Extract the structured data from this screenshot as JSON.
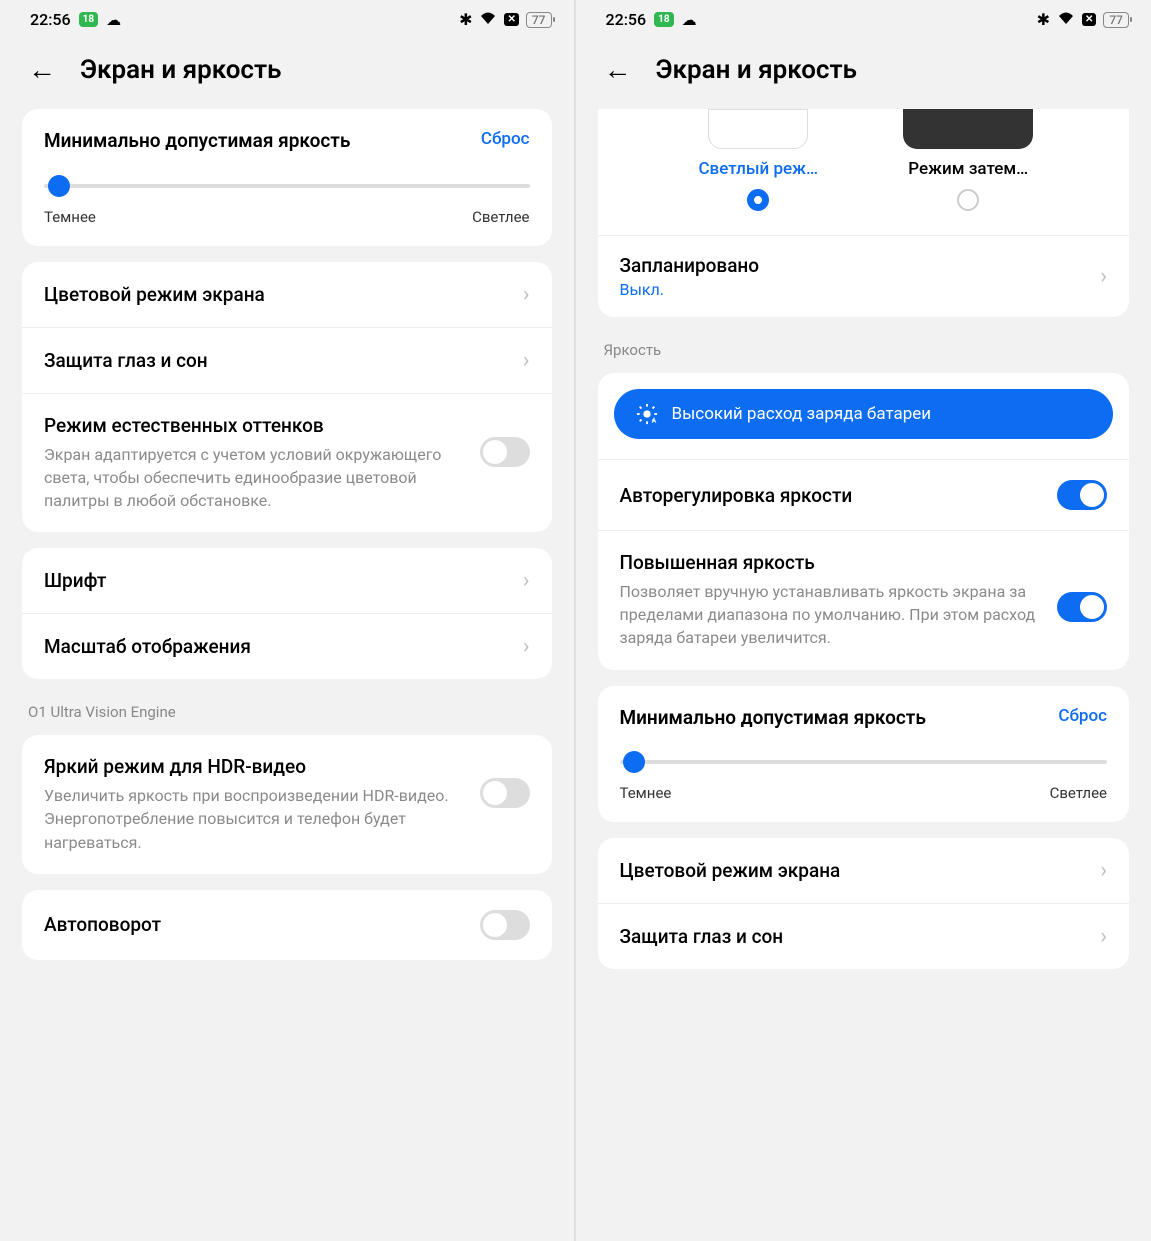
{
  "status": {
    "time": "22:56",
    "badge": "18",
    "battery": "77"
  },
  "header": {
    "title": "Экран и яркость"
  },
  "left": {
    "brightness_min": {
      "title": "Минимально допустимая яркость",
      "reset": "Сброс",
      "darker": "Темнее",
      "lighter": "Светлее"
    },
    "color_mode": "Цветовой режим экрана",
    "eye_protection": "Защита глаз и сон",
    "natural_tones": {
      "title": "Режим естественных оттенков",
      "desc": "Экран адаптируется с учетом условий окружающего света, чтобы обеспечить единообразие цветовой палитры в любой обстановке."
    },
    "font": "Шрифт",
    "display_scale": "Масштаб отображения",
    "ultra_vision_label": "O1 Ultra Vision Engine",
    "hdr": {
      "title": "Яркий режим для HDR-видео",
      "desc": "Увеличить яркость при воспроизведении HDR-видео. Энергопотребление повысится и телефон будет нагреваться."
    },
    "autorotate": "Автоповорот"
  },
  "right": {
    "light_mode": "Светлый реж…",
    "dark_mode": "Режим затем…",
    "scheduled": {
      "title": "Запланировано",
      "status": "Выкл."
    },
    "brightness_label": "Яркость",
    "high_usage": "Высокий расход заряда батареи",
    "auto_brightness": "Авторегулировка яркости",
    "boosted": {
      "title": "Повышенная яркость",
      "desc": "Позволяет вручную устанавливать яркость экрана за пределами диапазона по умолчанию. При этом расход заряда батареи увеличится."
    },
    "brightness_min": {
      "title": "Минимально допустимая яркость",
      "reset": "Сброс",
      "darker": "Темнее",
      "lighter": "Светлее"
    },
    "color_mode": "Цветовой режим экрана",
    "eye_protection": "Защита глаз и сон"
  }
}
